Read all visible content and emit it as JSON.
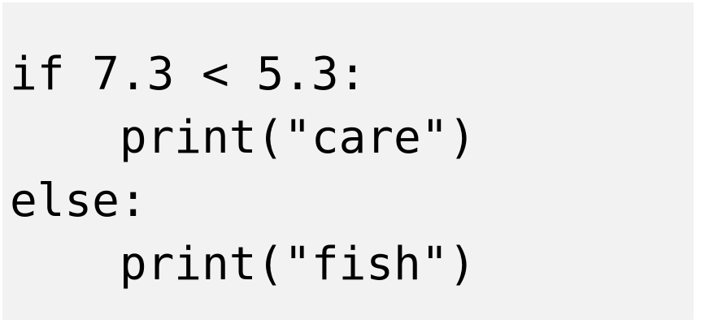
{
  "code": {
    "lines": [
      "if 7.3 < 5.3:",
      "    print(\"care\")",
      "else:",
      "    print(\"fish\")"
    ]
  }
}
